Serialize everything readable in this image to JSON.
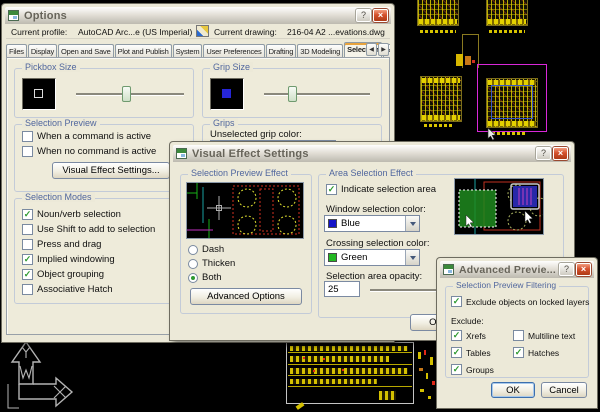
{
  "colors": {
    "window_selection_swatch": "#1414c8",
    "crossing_selection_swatch": "#22b822",
    "grip_swatch": "#2626d8"
  },
  "icons": {
    "help": "?",
    "close": "×",
    "check": "✓",
    "tab_prev": "◀",
    "tab_next": "▶"
  },
  "options_dialog": {
    "title": "Options",
    "profile_label": "Current profile:",
    "profile_value": "AutoCAD Arc...e (US Imperial)",
    "drawing_label": "Current drawing:",
    "drawing_value": "216-04 A2 ...evations.dwg",
    "tabs": [
      {
        "label": "Files",
        "active": false
      },
      {
        "label": "Display",
        "active": false
      },
      {
        "label": "Open and Save",
        "active": false
      },
      {
        "label": "Plot and Publish",
        "active": false
      },
      {
        "label": "System",
        "active": false
      },
      {
        "label": "User Preferences",
        "active": false
      },
      {
        "label": "Drafting",
        "active": false
      },
      {
        "label": "3D Modeling",
        "active": false
      },
      {
        "label": "Selection",
        "active": true
      },
      {
        "label": "P",
        "active": false
      }
    ],
    "pickbox_group_title": "Pickbox Size",
    "selection_preview": {
      "title": "Selection Preview",
      "cb_command_active": {
        "label": "When a command is active",
        "checked": false
      },
      "cb_no_command_active": {
        "label": "When no command is active",
        "checked": false
      },
      "visual_effect_button": "Visual Effect Settings..."
    },
    "selection_modes": {
      "title": "Selection Modes",
      "items": [
        {
          "label": "Noun/verb selection",
          "checked": true
        },
        {
          "label": "Use Shift to add to selection",
          "checked": false
        },
        {
          "label": "Press and drag",
          "checked": false
        },
        {
          "label": "Implied windowing",
          "checked": true
        },
        {
          "label": "Object grouping",
          "checked": true
        },
        {
          "label": "Associative Hatch",
          "checked": false
        }
      ]
    },
    "grip_group_title": "Grip Size",
    "grips": {
      "title": "Grips",
      "unselected_label": "Unselected grip color:"
    }
  },
  "ves_dialog": {
    "title": "Visual Effect Settings",
    "preview_group": {
      "title": "Selection Preview Effect",
      "radios": [
        {
          "label": "Dash",
          "selected": false
        },
        {
          "label": "Thicken",
          "selected": false
        },
        {
          "label": "Both",
          "selected": true
        }
      ],
      "advanced_button": "Advanced Options"
    },
    "area_group": {
      "title": "Area Selection Effect",
      "indicate": {
        "label": "Indicate selection area",
        "checked": true
      },
      "window_label": "Window selection color:",
      "window_value": "Blue",
      "crossing_label": "Crossing selection color:",
      "crossing_value": "Green",
      "opacity_label": "Selection area opacity:",
      "opacity_value": "25"
    },
    "ok_button": "OK"
  },
  "adv_dialog": {
    "title": "Advanced Previe...",
    "group_title": "Selection Preview Filtering",
    "locked": {
      "label": "Exclude objects on locked layers",
      "checked": true
    },
    "exclude_label": "Exclude:",
    "items": [
      {
        "label": "Xrefs",
        "checked": true
      },
      {
        "label": "Multiline text",
        "checked": false
      },
      {
        "label": "Tables",
        "checked": true
      },
      {
        "label": "Hatches",
        "checked": true
      },
      {
        "label": "Groups",
        "checked": true
      }
    ],
    "ok_button": "OK",
    "cancel_button": "Cancel"
  }
}
